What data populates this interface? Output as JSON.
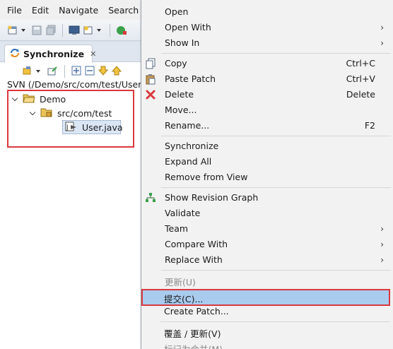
{
  "menubar": {
    "items": [
      "File",
      "Edit",
      "Navigate",
      "Search"
    ]
  },
  "view": {
    "tab_title": "Synchronize",
    "tab_close": "✕",
    "path": "SVN (/Demo/src/com/test/User.",
    "tree": {
      "project": "Demo",
      "package": "src/com/test",
      "file": "User.java"
    }
  },
  "context_menu": {
    "items": [
      {
        "label": "Open",
        "accel": "",
        "submenu": false
      },
      {
        "label": "Open With",
        "accel": "",
        "submenu": true
      },
      {
        "label": "Show In",
        "accel": "",
        "submenu": true
      },
      {
        "label": "Copy",
        "accel": "Ctrl+C",
        "submenu": false,
        "icon": "copy-icon"
      },
      {
        "label": "Paste Patch",
        "accel": "Ctrl+V",
        "submenu": false,
        "icon": "paste-icon"
      },
      {
        "label": "Delete",
        "accel": "Delete",
        "submenu": false,
        "icon": "delete-icon"
      },
      {
        "label": "Move...",
        "accel": "",
        "submenu": false
      },
      {
        "label": "Rename...",
        "accel": "F2",
        "submenu": false
      },
      {
        "label": "Synchronize",
        "accel": "",
        "submenu": false
      },
      {
        "label": "Expand All",
        "accel": "",
        "submenu": false
      },
      {
        "label": "Remove from View",
        "accel": "",
        "submenu": false
      },
      {
        "label": "Show Revision Graph",
        "accel": "",
        "submenu": false,
        "icon": "revision-graph-icon"
      },
      {
        "label": "Validate",
        "accel": "",
        "submenu": false
      },
      {
        "label": "Team",
        "accel": "",
        "submenu": true
      },
      {
        "label": "Compare With",
        "accel": "",
        "submenu": true
      },
      {
        "label": "Replace With",
        "accel": "",
        "submenu": true
      },
      {
        "label": "更新(U)",
        "accel": "",
        "submenu": false,
        "disabled": true
      },
      {
        "label": "提交(C)...",
        "accel": "",
        "submenu": false,
        "highlighted": true
      },
      {
        "label": "Create Patch...",
        "accel": "",
        "submenu": false
      },
      {
        "label": "覆盖 / 更新(V)",
        "accel": "",
        "submenu": false
      },
      {
        "label": "标记为合并(M)",
        "accel": "",
        "submenu": false,
        "disabled": true
      }
    ],
    "submenu_arrow": "›"
  },
  "colors": {
    "highlight_border": "#d9393e",
    "selection": "#a9cbee",
    "menu_bg": "#f2f2f2"
  }
}
